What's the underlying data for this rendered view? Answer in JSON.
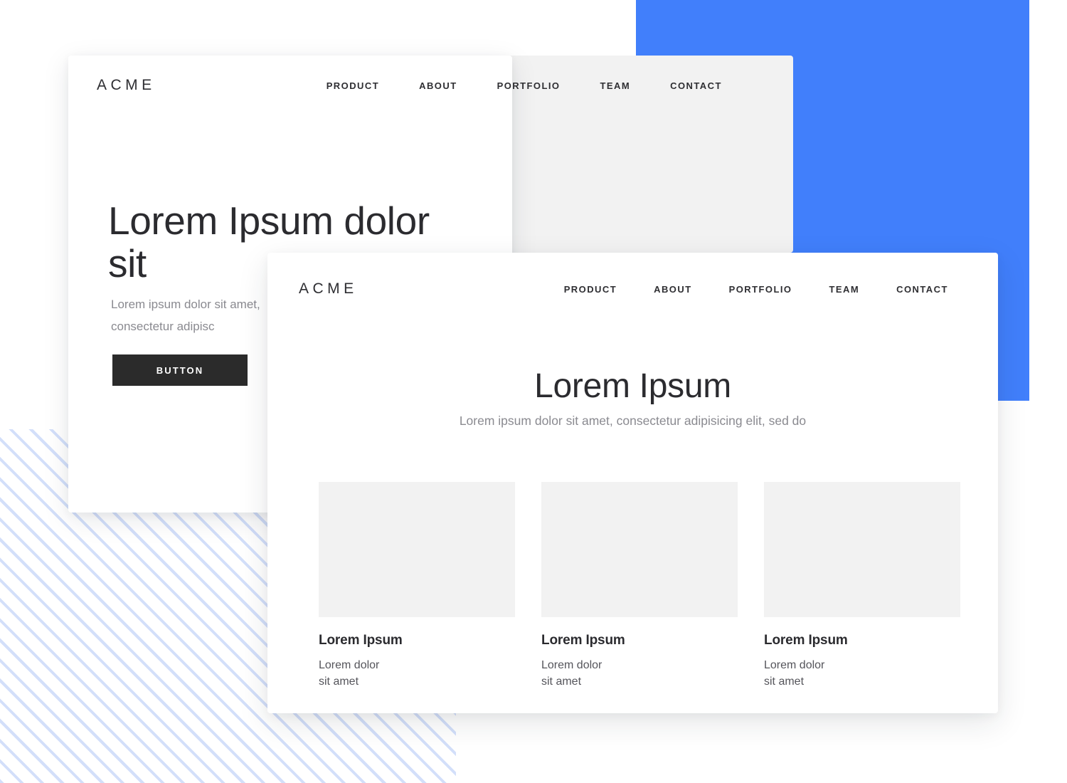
{
  "background": {
    "page_color": "#ffffff",
    "blue_square_color": "#417ffb",
    "hatch_stripe_color": "#d3dffa",
    "grey_card_color": "#f2f2f2"
  },
  "hero_card": {
    "logo": "ACME",
    "nav": [
      {
        "label": "PRODUCT"
      },
      {
        "label": "ABOUT"
      },
      {
        "label": "PORTFOLIO"
      },
      {
        "label": "TEAM"
      },
      {
        "label": "CONTACT"
      }
    ],
    "title": "Lorem Ipsum dolor sit",
    "subtitle": "Lorem ipsum dolor sit amet, consectetur adipisc",
    "button_label": "BUTTON",
    "button_color": "#2b2b2b"
  },
  "features_card": {
    "logo": "ACME",
    "nav": [
      {
        "label": "PRODUCT"
      },
      {
        "label": "ABOUT"
      },
      {
        "label": "PORTFOLIO"
      },
      {
        "label": "TEAM"
      },
      {
        "label": "CONTACT"
      }
    ],
    "title": "Lorem Ipsum",
    "subtitle": "Lorem ipsum dolor sit amet,\nconsectetur adipisicing elit, sed do",
    "items": [
      {
        "title": "Lorem Ipsum",
        "desc": "Lorem dolor\nsit amet"
      },
      {
        "title": "Lorem Ipsum",
        "desc": "Lorem dolor\nsit amet"
      },
      {
        "title": "Lorem Ipsum",
        "desc": "Lorem dolor\nsit amet"
      }
    ]
  }
}
